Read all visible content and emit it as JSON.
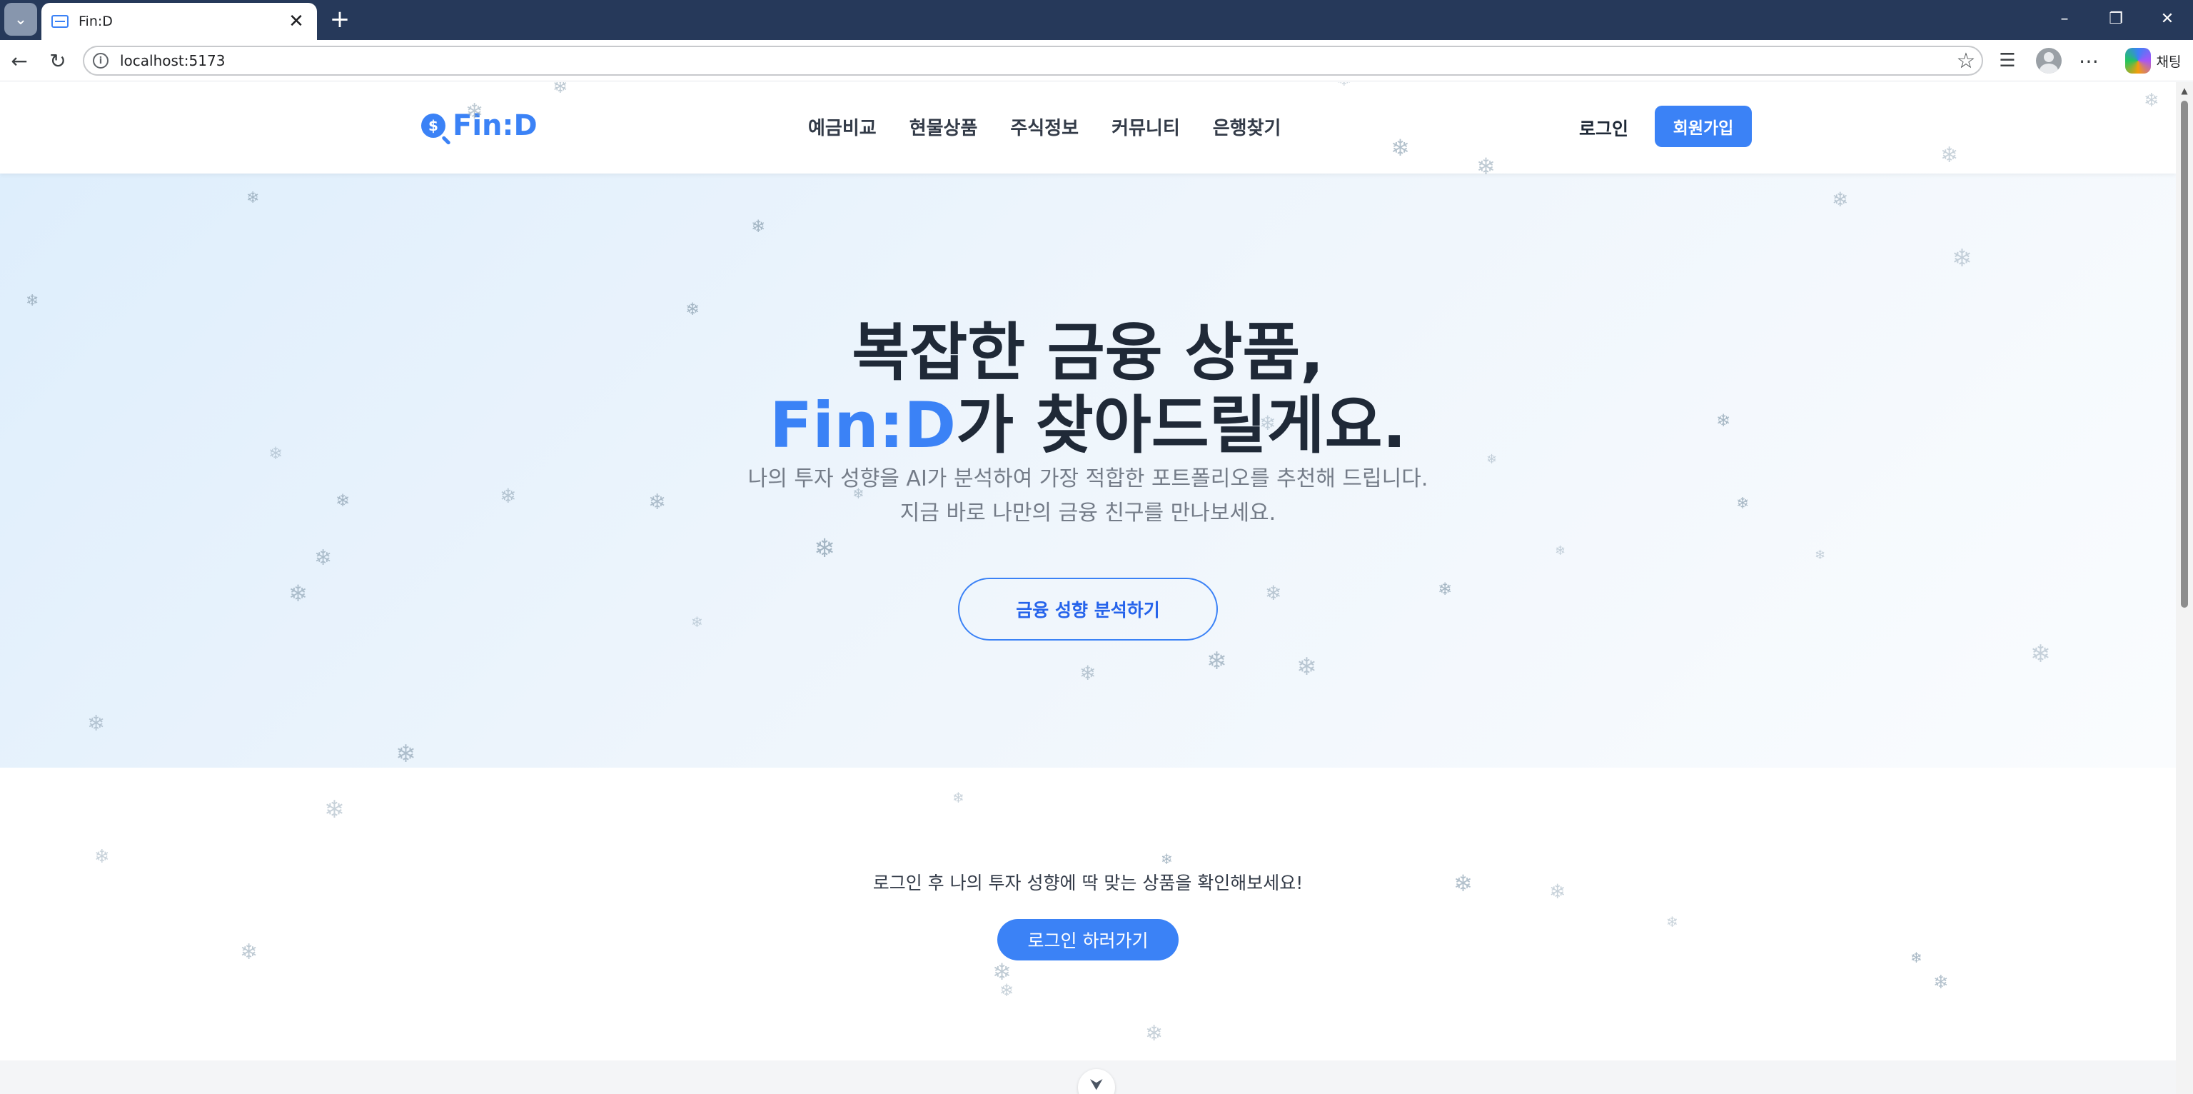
{
  "browser": {
    "tab_title": "Fin:D",
    "tab_close_glyph": "✕",
    "new_tab_glyph": "+",
    "tab_list_glyph": "⌄",
    "url": "localhost:5173",
    "chat_label": "채팅",
    "window_controls": {
      "minimize": "–",
      "restore": "❐",
      "close": "✕"
    },
    "toolbar_glyphs": {
      "back": "←",
      "reload": "↻",
      "info": "i",
      "favorite": "☆",
      "collections": "☰",
      "more": "⋯"
    }
  },
  "header": {
    "logo_text": "Fin:D",
    "logo_icon_glyph": "$",
    "nav": [
      "예금비교",
      "현물상품",
      "주식정보",
      "커뮤니티",
      "은행찾기"
    ],
    "login_label": "로그인",
    "signup_label": "회원가입"
  },
  "hero": {
    "title_line1": "복잡한 금융 상품,",
    "title_brand": "Fin:D",
    "title_line2_rest": "가 찾아드릴게요.",
    "subtitle_line1": "나의 투자 성향을 AI가 분석하여 가장 적합한 포트폴리오를 추천해 드립니다.",
    "subtitle_line2": "지금 바로 나만의 금융 친구를 만나보세요.",
    "cta_label": "금융 성향 분석하기"
  },
  "login_prompt": {
    "text": "로그인 후 나의 투자 성향에 딱 맞는 상품을 확인해보세요!",
    "button_label": "로그인 하러가기"
  },
  "scroll_down_glyph": "⮟",
  "snowflake_glyph": "❄",
  "colors": {
    "brand": "#3b82f6",
    "titlebar": "#26395a",
    "text_dark": "#1f2937",
    "text_muted": "#747c88",
    "snowflake": "#93a7b7"
  }
}
